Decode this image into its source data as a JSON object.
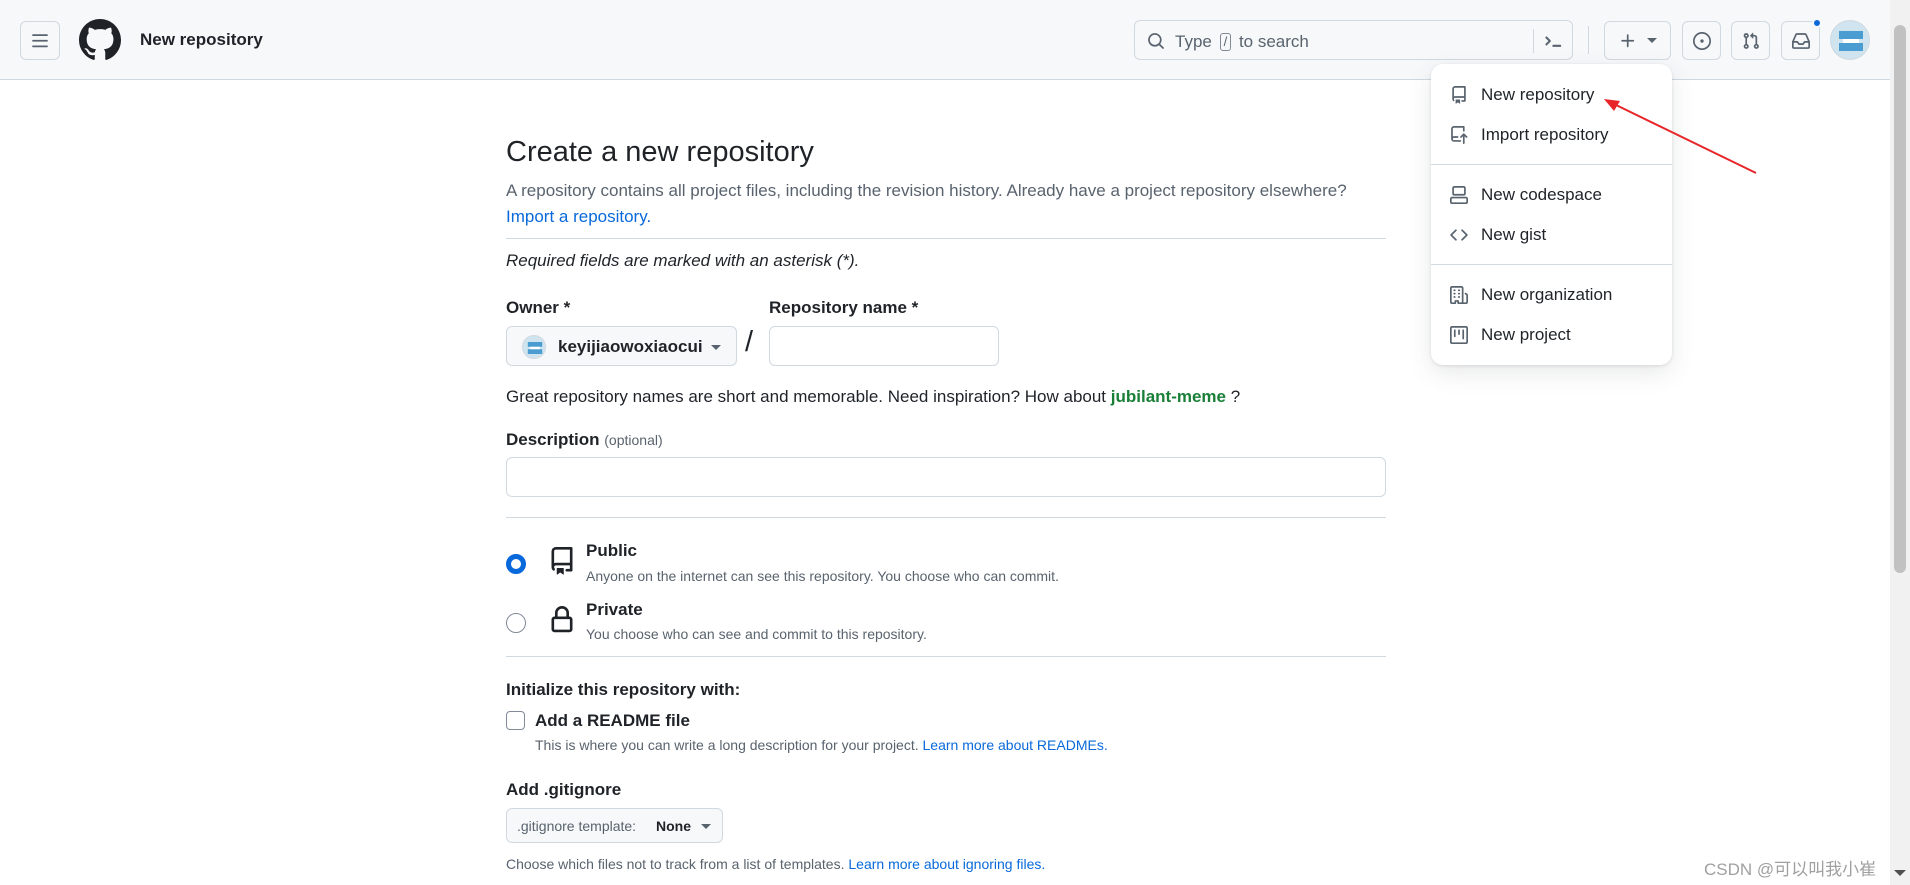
{
  "header": {
    "title": "New repository",
    "search_placeholder_pre": "Type",
    "search_key": "/",
    "search_placeholder_post": "to search"
  },
  "main": {
    "heading": "Create a new repository",
    "subtitle": "A repository contains all project files, including the revision history. Already have a project repository elsewhere?",
    "import_link": "Import a repository.",
    "required_note": "Required fields are marked with an asterisk (*).",
    "owner_label": "Owner *",
    "owner_value": "keyijiaowoxiaocui",
    "slash": "/",
    "repo_name_label": "Repository name *",
    "repo_name_value": "",
    "hint_pre": "Great repository names are short and memorable. Need inspiration? How about",
    "hint_suggestion": "jubilant-meme",
    "hint_post": "?",
    "description_label": "Description",
    "description_optional": "(optional)",
    "description_value": "",
    "visibility": [
      {
        "title": "Public",
        "desc": "Anyone on the internet can see this repository. You choose who can commit.",
        "checked": true
      },
      {
        "title": "Private",
        "desc": "You choose who can see and commit to this repository.",
        "checked": false
      }
    ],
    "init_label": "Initialize this repository with:",
    "readme_label": "Add a README file",
    "readme_desc": "This is where you can write a long description for your project.",
    "readme_link": "Learn more about READMEs.",
    "gitignore_label": "Add .gitignore",
    "gitignore_btn_prefix": ".gitignore template:",
    "gitignore_btn_value": "None",
    "gitignore_desc": "Choose which files not to track from a list of templates.",
    "gitignore_link": "Learn more about ignoring files."
  },
  "dropdown": {
    "items": [
      {
        "label": "New repository",
        "icon": "repo-icon"
      },
      {
        "label": "Import repository",
        "icon": "repo-push-icon"
      },
      {
        "label": "New codespace",
        "icon": "codespaces-icon"
      },
      {
        "label": "New gist",
        "icon": "code-icon"
      },
      {
        "label": "New organization",
        "icon": "organization-icon"
      },
      {
        "label": "New project",
        "icon": "project-icon"
      }
    ]
  },
  "watermark": "CSDN @可以叫我小崔",
  "colors": {
    "accent": "#0969da",
    "green": "#1a7f37",
    "arrow": "#e8262a"
  }
}
